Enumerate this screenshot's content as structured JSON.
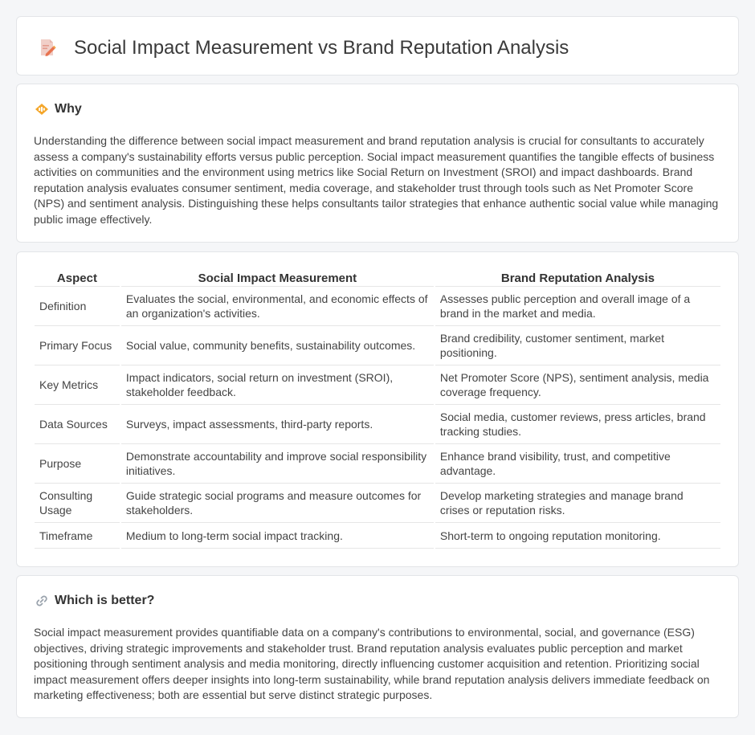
{
  "header": {
    "title": "Social Impact Measurement vs Brand Reputation Analysis"
  },
  "why": {
    "heading": "Why",
    "text": "Understanding the difference between social impact measurement and brand reputation analysis is crucial for consultants to accurately assess a company's sustainability efforts versus public perception. Social impact measurement quantifies the tangible effects of business activities on communities and the environment using metrics like Social Return on Investment (SROI) and impact dashboards. Brand reputation analysis evaluates consumer sentiment, media coverage, and stakeholder trust through tools such as Net Promoter Score (NPS) and sentiment analysis. Distinguishing these helps consultants tailor strategies that enhance authentic social value while managing public image effectively."
  },
  "table": {
    "headers": [
      "Aspect",
      "Social Impact Measurement",
      "Brand Reputation Analysis"
    ],
    "rows": [
      [
        "Definition",
        "Evaluates the social, environmental, and economic effects of an organization's activities.",
        "Assesses public perception and overall image of a brand in the market and media."
      ],
      [
        "Primary Focus",
        "Social value, community benefits, sustainability outcomes.",
        "Brand credibility, customer sentiment, market positioning."
      ],
      [
        "Key Metrics",
        "Impact indicators, social return on investment (SROI), stakeholder feedback.",
        "Net Promoter Score (NPS), sentiment analysis, media coverage frequency."
      ],
      [
        "Data Sources",
        "Surveys, impact assessments, third-party reports.",
        "Social media, customer reviews, press articles, brand tracking studies."
      ],
      [
        "Purpose",
        "Demonstrate accountability and improve social responsibility initiatives.",
        "Enhance brand visibility, trust, and competitive advantage."
      ],
      [
        "Consulting Usage",
        "Guide strategic social programs and measure outcomes for stakeholders.",
        "Develop marketing strategies and manage brand crises or reputation risks."
      ],
      [
        "Timeframe",
        "Medium to long-term social impact tracking.",
        "Short-term to ongoing reputation monitoring."
      ]
    ]
  },
  "better": {
    "heading": "Which is better?",
    "text": "Social impact measurement provides quantifiable data on a company's contributions to environmental, social, and governance (ESG) objectives, driving strategic improvements and stakeholder trust. Brand reputation analysis evaluates public perception and market positioning through sentiment analysis and media monitoring, directly influencing customer acquisition and retention. Prioritizing social impact measurement offers deeper insights into long-term sustainability, while brand reputation analysis delivers immediate feedback on marketing effectiveness; both are essential but serve distinct strategic purposes."
  }
}
